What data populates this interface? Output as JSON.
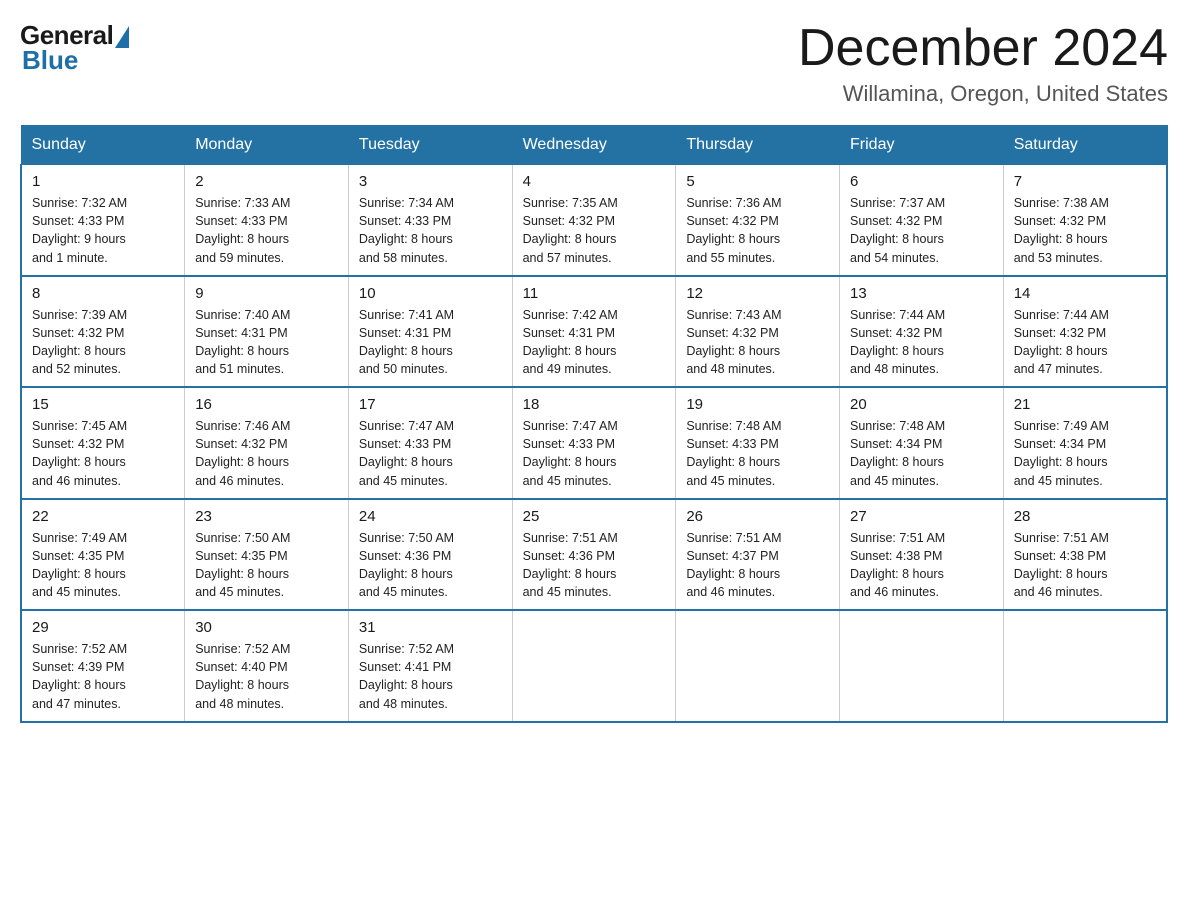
{
  "header": {
    "logo": {
      "general": "General",
      "blue": "Blue"
    },
    "title": "December 2024",
    "location": "Willamina, Oregon, United States"
  },
  "days_of_week": [
    "Sunday",
    "Monday",
    "Tuesday",
    "Wednesday",
    "Thursday",
    "Friday",
    "Saturday"
  ],
  "weeks": [
    [
      {
        "day": "1",
        "sunrise": "7:32 AM",
        "sunset": "4:33 PM",
        "daylight": "9 hours and 1 minute."
      },
      {
        "day": "2",
        "sunrise": "7:33 AM",
        "sunset": "4:33 PM",
        "daylight": "8 hours and 59 minutes."
      },
      {
        "day": "3",
        "sunrise": "7:34 AM",
        "sunset": "4:33 PM",
        "daylight": "8 hours and 58 minutes."
      },
      {
        "day": "4",
        "sunrise": "7:35 AM",
        "sunset": "4:32 PM",
        "daylight": "8 hours and 57 minutes."
      },
      {
        "day": "5",
        "sunrise": "7:36 AM",
        "sunset": "4:32 PM",
        "daylight": "8 hours and 55 minutes."
      },
      {
        "day": "6",
        "sunrise": "7:37 AM",
        "sunset": "4:32 PM",
        "daylight": "8 hours and 54 minutes."
      },
      {
        "day": "7",
        "sunrise": "7:38 AM",
        "sunset": "4:32 PM",
        "daylight": "8 hours and 53 minutes."
      }
    ],
    [
      {
        "day": "8",
        "sunrise": "7:39 AM",
        "sunset": "4:32 PM",
        "daylight": "8 hours and 52 minutes."
      },
      {
        "day": "9",
        "sunrise": "7:40 AM",
        "sunset": "4:31 PM",
        "daylight": "8 hours and 51 minutes."
      },
      {
        "day": "10",
        "sunrise": "7:41 AM",
        "sunset": "4:31 PM",
        "daylight": "8 hours and 50 minutes."
      },
      {
        "day": "11",
        "sunrise": "7:42 AM",
        "sunset": "4:31 PM",
        "daylight": "8 hours and 49 minutes."
      },
      {
        "day": "12",
        "sunrise": "7:43 AM",
        "sunset": "4:32 PM",
        "daylight": "8 hours and 48 minutes."
      },
      {
        "day": "13",
        "sunrise": "7:44 AM",
        "sunset": "4:32 PM",
        "daylight": "8 hours and 48 minutes."
      },
      {
        "day": "14",
        "sunrise": "7:44 AM",
        "sunset": "4:32 PM",
        "daylight": "8 hours and 47 minutes."
      }
    ],
    [
      {
        "day": "15",
        "sunrise": "7:45 AM",
        "sunset": "4:32 PM",
        "daylight": "8 hours and 46 minutes."
      },
      {
        "day": "16",
        "sunrise": "7:46 AM",
        "sunset": "4:32 PM",
        "daylight": "8 hours and 46 minutes."
      },
      {
        "day": "17",
        "sunrise": "7:47 AM",
        "sunset": "4:33 PM",
        "daylight": "8 hours and 45 minutes."
      },
      {
        "day": "18",
        "sunrise": "7:47 AM",
        "sunset": "4:33 PM",
        "daylight": "8 hours and 45 minutes."
      },
      {
        "day": "19",
        "sunrise": "7:48 AM",
        "sunset": "4:33 PM",
        "daylight": "8 hours and 45 minutes."
      },
      {
        "day": "20",
        "sunrise": "7:48 AM",
        "sunset": "4:34 PM",
        "daylight": "8 hours and 45 minutes."
      },
      {
        "day": "21",
        "sunrise": "7:49 AM",
        "sunset": "4:34 PM",
        "daylight": "8 hours and 45 minutes."
      }
    ],
    [
      {
        "day": "22",
        "sunrise": "7:49 AM",
        "sunset": "4:35 PM",
        "daylight": "8 hours and 45 minutes."
      },
      {
        "day": "23",
        "sunrise": "7:50 AM",
        "sunset": "4:35 PM",
        "daylight": "8 hours and 45 minutes."
      },
      {
        "day": "24",
        "sunrise": "7:50 AM",
        "sunset": "4:36 PM",
        "daylight": "8 hours and 45 minutes."
      },
      {
        "day": "25",
        "sunrise": "7:51 AM",
        "sunset": "4:36 PM",
        "daylight": "8 hours and 45 minutes."
      },
      {
        "day": "26",
        "sunrise": "7:51 AM",
        "sunset": "4:37 PM",
        "daylight": "8 hours and 46 minutes."
      },
      {
        "day": "27",
        "sunrise": "7:51 AM",
        "sunset": "4:38 PM",
        "daylight": "8 hours and 46 minutes."
      },
      {
        "day": "28",
        "sunrise": "7:51 AM",
        "sunset": "4:38 PM",
        "daylight": "8 hours and 46 minutes."
      }
    ],
    [
      {
        "day": "29",
        "sunrise": "7:52 AM",
        "sunset": "4:39 PM",
        "daylight": "8 hours and 47 minutes."
      },
      {
        "day": "30",
        "sunrise": "7:52 AM",
        "sunset": "4:40 PM",
        "daylight": "8 hours and 48 minutes."
      },
      {
        "day": "31",
        "sunrise": "7:52 AM",
        "sunset": "4:41 PM",
        "daylight": "8 hours and 48 minutes."
      },
      null,
      null,
      null,
      null
    ]
  ],
  "labels": {
    "sunrise": "Sunrise:",
    "sunset": "Sunset:",
    "daylight": "Daylight:"
  }
}
